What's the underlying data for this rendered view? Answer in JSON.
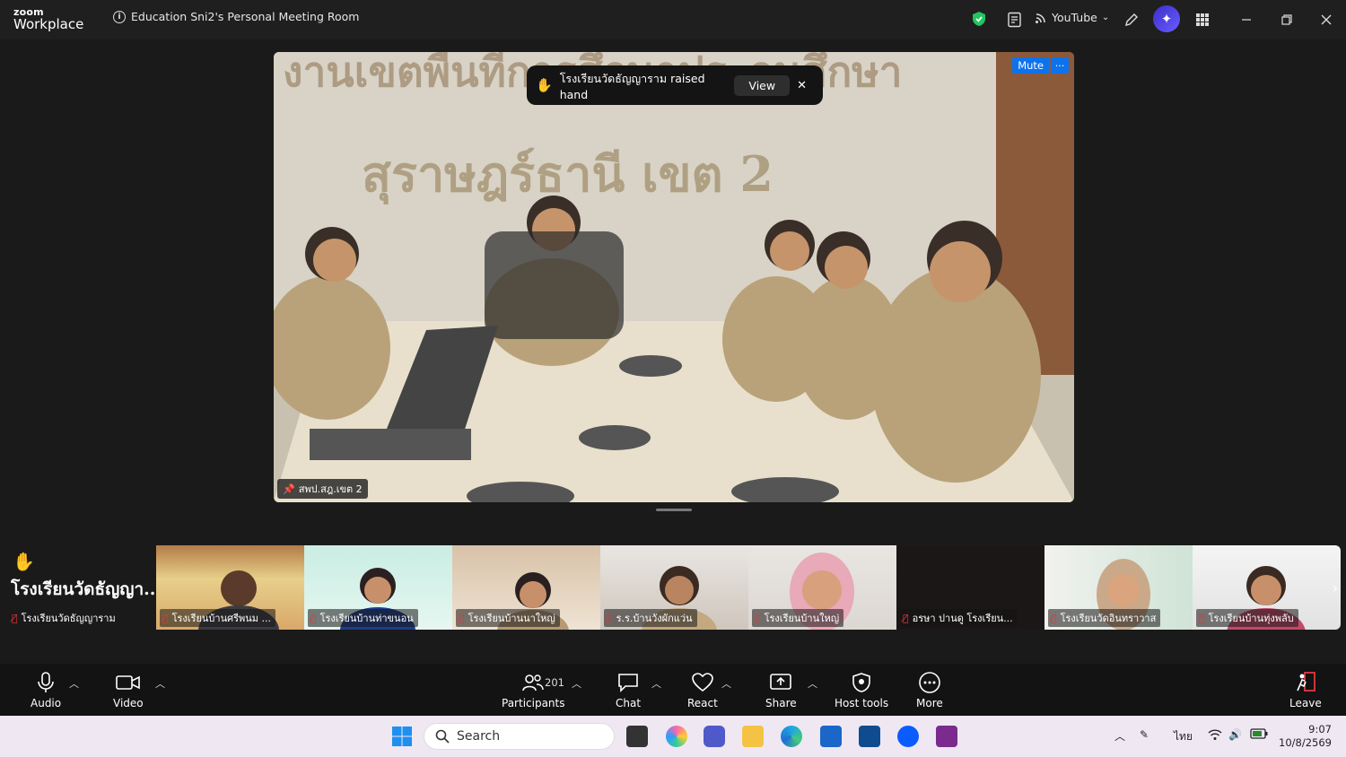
{
  "app": {
    "logo_top": "zoom",
    "logo_bottom": "Workplace",
    "meeting_title": "Education Sni2's Personal Meeting Room",
    "stream_label": "YouTube"
  },
  "notification": {
    "text": "โรงเรียนวัดธัญญาราม raised hand",
    "view_label": "View",
    "close_label": "✕"
  },
  "main_video": {
    "mute_label": "Mute",
    "more_label": "···",
    "name": "สพป.สฎ.เขต 2",
    "wall_text_top": "งานเขตพื้นที่การศึกษาประถมศึกษา",
    "wall_text_main": "สุราษฎร์ธานี  เขต 2"
  },
  "spotlight_tile": {
    "hand": "✋",
    "display_name": "โรงเรียนวัดธัญญา...",
    "label": "โรงเรียนวัดธัญญาราม"
  },
  "thumbnails": [
    {
      "label": "โรงเรียนบ้านศรีพนม ..."
    },
    {
      "label": "โรงเรียนบ้านท่าขนอน"
    },
    {
      "label": "โรงเรียนบ้านนาใหญ่"
    },
    {
      "label": "ร.ร.บ้านวังผักแว่น"
    },
    {
      "label": "โรงเรียนบ้านใหญ่"
    },
    {
      "label": "อรษา ปานดู โรงเรียน..."
    },
    {
      "label": "โรงเรียนวัดอินทราวาส"
    },
    {
      "label": "โรงเรียนบ้านทุ่งพลับ"
    }
  ],
  "toolbar": {
    "audio": "Audio",
    "video": "Video",
    "participants": "Participants",
    "participant_count": "201",
    "chat": "Chat",
    "react": "React",
    "share": "Share",
    "host_tools": "Host tools",
    "more": "More",
    "leave": "Leave"
  },
  "taskbar": {
    "search_placeholder": "Search",
    "lang": "ไทย",
    "time": "9:07",
    "date": "10/8/2569"
  },
  "colors": {
    "accent": "#0e72ed",
    "mic_off": "#e0393e",
    "security_green": "#22c55e"
  }
}
